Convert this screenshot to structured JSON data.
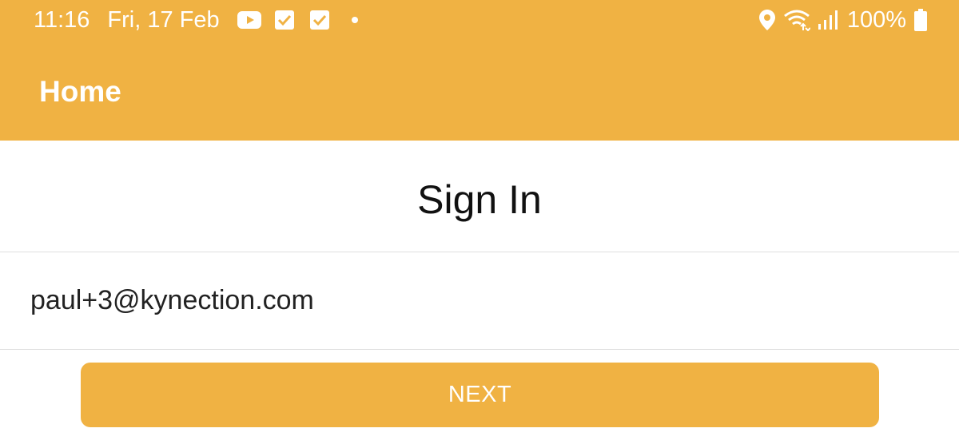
{
  "colors": {
    "accent": "#F0B243",
    "background": "#FFFFFF",
    "text_primary": "#111111",
    "on_accent": "#FFFFFF",
    "divider": "#DEDEDE"
  },
  "status_bar": {
    "time": "11:16",
    "date": "Fri, 17 Feb",
    "left_icons": [
      "youtube-icon",
      "mail-check-icon",
      "mail-check-icon",
      "dot-icon"
    ],
    "right_icons": [
      "location-icon",
      "wifi-icon",
      "signal-icon"
    ],
    "battery_percent": "100%"
  },
  "app_bar": {
    "title": "Home"
  },
  "sign_in": {
    "title": "Sign In",
    "email_value": "paul+3@kynection.com",
    "next_label": "NEXT"
  }
}
